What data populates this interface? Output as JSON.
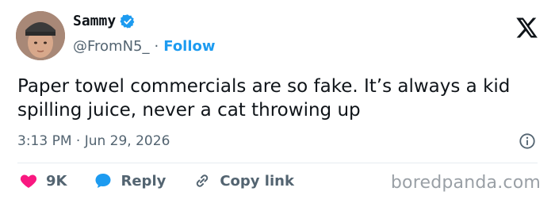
{
  "user": {
    "display_name": "Sammy",
    "handle": "@FromN5_",
    "separator": "·",
    "follow_label": "Follow"
  },
  "tweet": {
    "text": "Paper towel commercials are so fake. It’s always a kid spilling juice, never a cat throwing up",
    "timestamp": "3:13 PM · Jun 29, 2026"
  },
  "actions": {
    "likes": "9K",
    "reply_label": "Reply",
    "copy_link_label": "Copy link"
  },
  "watermark": "boredpanda.com",
  "icons": {
    "verified": "verified-badge-icon",
    "brand": "x-logo-icon",
    "info": "info-icon",
    "like": "heart-icon",
    "reply": "speech-bubble-icon",
    "copy": "link-icon"
  },
  "colors": {
    "accent": "#1d9bf0",
    "like": "#f91880",
    "text": "#0f1419",
    "muted": "#536471"
  }
}
